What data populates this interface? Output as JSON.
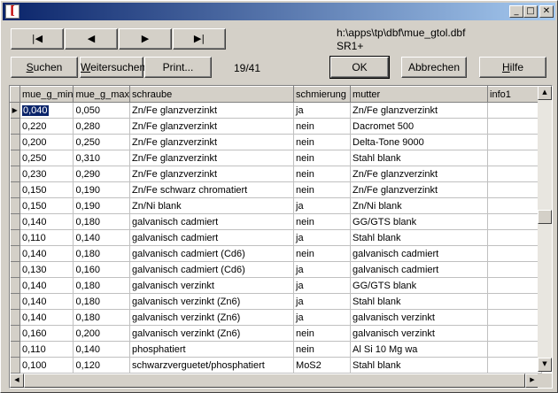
{
  "titlebar": {
    "title": "",
    "icon": "app-icon",
    "controls": {
      "minimize": "_",
      "maximize": "□",
      "close": "✕"
    }
  },
  "nav": {
    "first": "|◀",
    "prev": "◀",
    "next": "▶",
    "last": "▶|"
  },
  "info": {
    "path": "h:\\apps\\tp\\dbf\\mue_gtol.dbf",
    "record_name": "SR1+",
    "position": "19/41"
  },
  "buttons": {
    "search": {
      "pre": "",
      "u": "S",
      "post": "uchen"
    },
    "search_next": {
      "pre": "",
      "u": "W",
      "post": "eitersuchen"
    },
    "print": "Print...",
    "ok": "OK",
    "cancel": "Abbrechen",
    "help": {
      "pre": "",
      "u": "H",
      "post": "ilfe"
    }
  },
  "table": {
    "columns": [
      "mue_g_min",
      "mue_g_max",
      "schraube",
      "schmierung",
      "mutter",
      "info1"
    ],
    "rows": [
      [
        "0,040",
        "0,050",
        "Zn/Fe glanzverzinkt",
        "ja",
        "Zn/Fe glanzverzinkt",
        ""
      ],
      [
        "0,220",
        "0,280",
        "Zn/Fe glanzverzinkt",
        "nein",
        "Dacromet 500",
        ""
      ],
      [
        "0,200",
        "0,250",
        "Zn/Fe glanzverzinkt",
        "nein",
        "Delta-Tone 9000",
        ""
      ],
      [
        "0,250",
        "0,310",
        "Zn/Fe glanzverzinkt",
        "nein",
        "Stahl blank",
        ""
      ],
      [
        "0,230",
        "0,290",
        "Zn/Fe glanzverzinkt",
        "nein",
        "Zn/Fe glanzverzinkt",
        ""
      ],
      [
        "0,150",
        "0,190",
        "Zn/Fe schwarz chromatiert",
        "nein",
        "Zn/Fe glanzverzinkt",
        ""
      ],
      [
        "0,150",
        "0,190",
        "Zn/Ni blank",
        "ja",
        "Zn/Ni blank",
        ""
      ],
      [
        "0,140",
        "0,180",
        "galvanisch cadmiert",
        "nein",
        "GG/GTS blank",
        ""
      ],
      [
        "0,110",
        "0,140",
        "galvanisch cadmiert",
        "ja",
        "Stahl blank",
        ""
      ],
      [
        "0,140",
        "0,180",
        "galvanisch cadmiert (Cd6)",
        "nein",
        "galvanisch cadmiert",
        ""
      ],
      [
        "0,130",
        "0,160",
        "galvanisch cadmiert (Cd6)",
        "ja",
        "galvanisch cadmiert",
        ""
      ],
      [
        "0,140",
        "0,180",
        "galvanisch verzinkt",
        "ja",
        "GG/GTS blank",
        ""
      ],
      [
        "0,140",
        "0,180",
        "galvanisch verzinkt (Zn6)",
        "ja",
        "Stahl blank",
        ""
      ],
      [
        "0,140",
        "0,180",
        "galvanisch verzinkt (Zn6)",
        "ja",
        "galvanisch verzinkt",
        ""
      ],
      [
        "0,160",
        "0,200",
        "galvanisch verzinkt (Zn6)",
        "nein",
        "galvanisch verzinkt",
        ""
      ],
      [
        "0,110",
        "0,140",
        "phosphatiert",
        "nein",
        "Al Si 10 Mg wa",
        ""
      ],
      [
        "0,100",
        "0,120",
        "schwarzverguetet/phosphatiert",
        "MoS2",
        "Stahl blank",
        ""
      ]
    ],
    "current_row": 0,
    "current_indicator": "▶",
    "vscroll_position": 0.45
  },
  "scroll": {
    "up": "▲",
    "down": "▼",
    "left": "◀",
    "right": "▶"
  },
  "colors": {
    "selection": "#0a246a",
    "titlebar_start": "#0a246a",
    "titlebar_end": "#a6caf0"
  }
}
